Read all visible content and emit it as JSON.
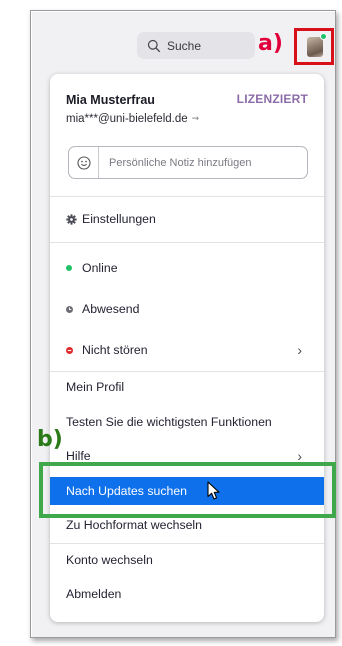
{
  "topbar": {
    "search_label": "Suche",
    "annotation_a": "a)",
    "status_color": "#21c267"
  },
  "profile": {
    "name": "Mia Musterfrau",
    "license": "LIZENZIERT",
    "email": "mia***@uni-bielefeld.de",
    "note_placeholder": "Persönliche Notiz hinzufügen"
  },
  "menu": {
    "settings": "Einstellungen",
    "status_online": "Online",
    "status_away": "Abwesend",
    "status_dnd": "Nicht stören",
    "my_profile": "Mein Profil",
    "try_features": "Testen Sie die wichtigsten Funktionen",
    "help": "Hilfe",
    "check_updates": "Nach Updates suchen",
    "portrait": "Zu Hochformat wechseln",
    "switch_account": "Konto wechseln",
    "sign_out": "Abmelden",
    "annotation_b": "b)"
  },
  "colors": {
    "highlight": "#0e71eb",
    "license": "#8c6ca8",
    "online": "#21c267",
    "away": "#6e6e78",
    "dnd": "#e02828",
    "annotation_a": "#e0003a",
    "annotation_b": "#2a7a19"
  }
}
